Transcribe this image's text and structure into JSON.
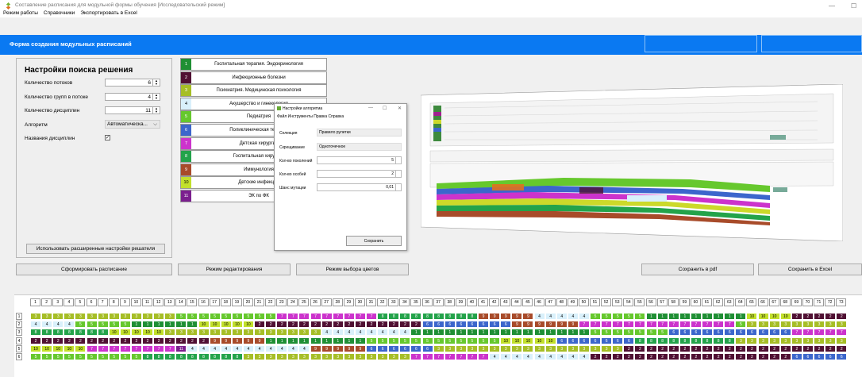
{
  "window": {
    "title": "Составление расписания для модульной формы обучения [Исследовательский режим]",
    "minimize": "—",
    "maximize": "☐"
  },
  "menu": [
    "Режим работы",
    "Справочники",
    "Экспортировать в Excel"
  ],
  "header": {
    "title": "Форма создания модульных  расписаний"
  },
  "settings": {
    "title": "Настройки поиска решения",
    "rows": [
      {
        "label": "Количество потоков",
        "value": "6"
      },
      {
        "label": "Количество групп в потоке",
        "value": "4"
      },
      {
        "label": "Количество дисциплин",
        "value": "11"
      }
    ],
    "algorithm_label": "Алгоритм",
    "algorithm_value": "Автоматическа...",
    "names_label": "Названия дисциплин",
    "names_checked": "✓",
    "advanced_button": "Использовать расширенные настройки решателя"
  },
  "subjects": [
    {
      "num": "1",
      "label": "Госпитальная терапия. Эндокринология",
      "color": "#1f8f34",
      "text": "#fff"
    },
    {
      "num": "2",
      "label": "Инфекционные болезни",
      "color": "#501033",
      "text": "#fff"
    },
    {
      "num": "3",
      "label": "Психиатрия. Медицинская психология",
      "color": "#a6be26",
      "text": "#fff"
    },
    {
      "num": "4",
      "label": "Акушерство и гинекология",
      "color": "#d9f0fb",
      "text": "#000"
    },
    {
      "num": "5",
      "label": "Педиатрия",
      "color": "#66c82d",
      "text": "#fff"
    },
    {
      "num": "6",
      "label": "Поликлиническая терапия",
      "color": "#3c66cc",
      "text": "#fff"
    },
    {
      "num": "7",
      "label": "Детская хирургия",
      "color": "#cc33cc",
      "text": "#fff"
    },
    {
      "num": "8",
      "label": "Госпитальная хирургия",
      "color": "#23a34a",
      "text": "#fff"
    },
    {
      "num": "9",
      "label": "Иммунология",
      "color": "#a84b2a",
      "text": "#fff"
    },
    {
      "num": "10",
      "label": "Детские инфекции",
      "color": "#c2e02b",
      "text": "#000"
    },
    {
      "num": "11",
      "label": "ЭК по ФК",
      "color": "#7b1f8e",
      "text": "#fff"
    }
  ],
  "dialog": {
    "title": "Настройки алгоритма",
    "close": "✕",
    "min": "—",
    "max": "☐",
    "menu": "Файл  Инструменты  Правка  Справка",
    "selection_label": "Селекция",
    "selection_value": "Правило рулетки",
    "crossing_label": "Скрещивание",
    "crossing_value": "Одноточечное",
    "generations_label": "Кол-во поколений",
    "generations_value": "5",
    "individuals_label": "Кол-во особей",
    "individuals_value": "2",
    "mutation_label": "Шанс мутации",
    "mutation_value": "0,01",
    "save": "Сохранить"
  },
  "buttons": {
    "build": "Сформировать расписание",
    "edit": "Режим редактирования",
    "colors": "Режим выбора цветов",
    "pdf": "Сохранить в pdf",
    "excel": "Сохранить в Excel"
  },
  "grid": {
    "columns": 73,
    "row_labels": [
      "1",
      "2",
      "3",
      "4",
      "5",
      "6"
    ],
    "rows": [
      [
        3,
        3,
        3,
        3,
        3,
        3,
        3,
        3,
        3,
        3,
        3,
        3,
        3,
        5,
        5,
        5,
        5,
        5,
        5,
        5,
        5,
        5,
        7,
        7,
        7,
        7,
        7,
        7,
        7,
        7,
        7,
        8,
        8,
        8,
        8,
        8,
        8,
        8,
        8,
        8,
        9,
        9,
        9,
        9,
        9,
        4,
        4,
        4,
        4,
        4,
        5,
        5,
        5,
        5,
        5,
        1,
        1,
        1,
        1,
        1,
        1,
        1,
        1,
        1,
        10,
        10,
        10,
        10,
        2,
        2,
        2,
        2,
        2,
        2
      ],
      [
        4,
        4,
        4,
        4,
        5,
        5,
        5,
        5,
        5,
        1,
        1,
        1,
        1,
        1,
        1,
        10,
        10,
        10,
        10,
        10,
        2,
        2,
        2,
        2,
        2,
        2,
        2,
        2,
        2,
        2,
        2,
        2,
        2,
        2,
        2,
        6,
        6,
        6,
        6,
        6,
        6,
        6,
        6,
        9,
        9,
        9,
        9,
        9,
        9,
        7,
        7,
        7,
        7,
        7,
        7,
        7,
        7,
        7,
        7,
        7,
        7,
        7,
        7,
        5,
        3,
        3,
        3,
        3,
        3,
        3,
        3,
        3,
        3,
        3
      ],
      [
        8,
        8,
        8,
        8,
        8,
        8,
        8,
        10,
        10,
        10,
        10,
        10,
        3,
        3,
        3,
        3,
        3,
        3,
        3,
        3,
        3,
        3,
        3,
        3,
        3,
        3,
        4,
        4,
        4,
        4,
        4,
        4,
        4,
        4,
        1,
        1,
        1,
        1,
        1,
        1,
        1,
        1,
        1,
        1,
        1,
        1,
        1,
        1,
        1,
        1,
        5,
        5,
        5,
        5,
        5,
        5,
        5,
        6,
        6,
        6,
        6,
        6,
        6,
        6,
        6,
        6,
        6,
        6,
        7,
        7,
        7,
        7,
        7,
        7
      ],
      [
        2,
        2,
        2,
        2,
        2,
        2,
        2,
        2,
        2,
        2,
        2,
        2,
        2,
        2,
        2,
        2,
        9,
        9,
        9,
        9,
        9,
        1,
        1,
        1,
        1,
        1,
        1,
        1,
        1,
        1,
        5,
        5,
        5,
        5,
        5,
        5,
        5,
        5,
        5,
        5,
        5,
        5,
        10,
        10,
        10,
        10,
        10,
        6,
        6,
        6,
        6,
        6,
        6,
        6,
        8,
        8,
        8,
        8,
        8,
        8,
        8,
        8,
        8,
        3,
        3,
        3,
        3,
        3,
        3,
        3,
        3,
        3,
        3,
        3
      ],
      [
        10,
        10,
        10,
        10,
        10,
        7,
        7,
        7,
        7,
        7,
        7,
        7,
        7,
        11,
        4,
        4,
        4,
        4,
        4,
        4,
        4,
        4,
        4,
        4,
        4,
        9,
        9,
        9,
        9,
        9,
        6,
        6,
        6,
        6,
        6,
        6,
        3,
        3,
        3,
        3,
        3,
        3,
        3,
        3,
        3,
        3,
        3,
        3,
        3,
        3,
        3,
        3,
        3,
        2,
        2,
        2,
        2,
        2,
        2,
        2,
        2,
        2,
        2,
        2,
        2,
        2,
        2,
        2,
        2,
        2,
        2,
        2,
        2,
        2
      ],
      [
        5,
        5,
        5,
        5,
        5,
        5,
        5,
        5,
        5,
        5,
        8,
        8,
        8,
        8,
        8,
        8,
        8,
        8,
        8,
        3,
        3,
        3,
        3,
        3,
        3,
        3,
        3,
        3,
        3,
        3,
        3,
        3,
        3,
        3,
        7,
        7,
        7,
        7,
        7,
        7,
        7,
        4,
        4,
        4,
        4,
        4,
        4,
        4,
        4,
        4,
        2,
        2,
        2,
        2,
        2,
        2,
        2,
        2,
        2,
        2,
        2,
        2,
        2,
        2,
        2,
        2,
        2,
        2,
        6,
        6,
        6,
        6,
        6,
        6
      ]
    ]
  }
}
